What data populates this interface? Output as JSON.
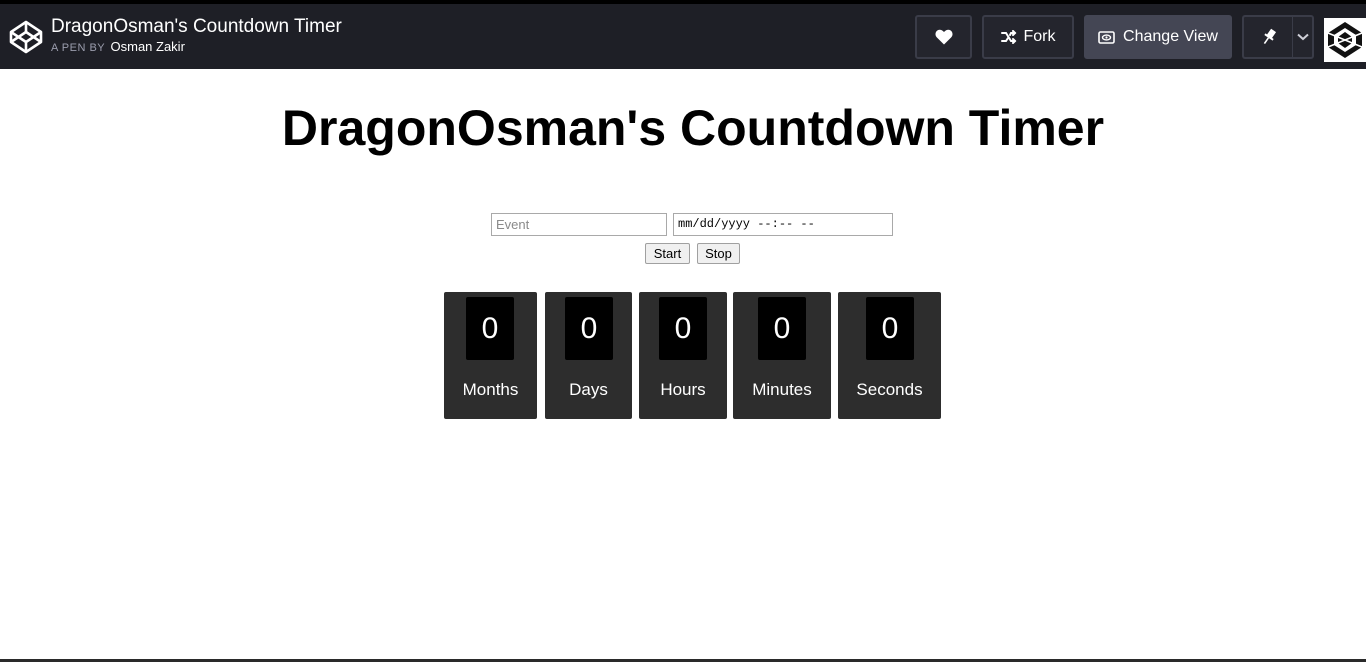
{
  "header": {
    "pen_title": "DragonOsman's Countdown Timer",
    "pen_by_prefix": "A PEN BY",
    "author": "Osman Zakir",
    "fork_label": "Fork",
    "change_view_label": "Change View",
    "icons": {
      "logo": "codepen-logo-icon",
      "heart": "heart-icon",
      "fork": "fork-icon",
      "view": "eye-icon",
      "pin": "pin-icon",
      "dropdown": "chevron-down-icon"
    },
    "colors": {
      "bar_bg": "#1e1f26",
      "button_bg": "#24252d",
      "change_view_bg": "#444654"
    }
  },
  "main": {
    "title": "DragonOsman's Countdown Timer",
    "event_placeholder": "Event",
    "datetime_value": "mm/dd/yyyy --:-- --",
    "start_label": "Start",
    "stop_label": "Stop",
    "units": [
      {
        "value": "0",
        "label": "Months"
      },
      {
        "value": "0",
        "label": "Days"
      },
      {
        "value": "0",
        "label": "Hours"
      },
      {
        "value": "0",
        "label": "Minutes"
      },
      {
        "value": "0",
        "label": "Seconds"
      }
    ],
    "colors": {
      "unit_bg": "#2d2d2d",
      "digit_bg": "#000000",
      "digit_text": "#ffffff"
    }
  }
}
